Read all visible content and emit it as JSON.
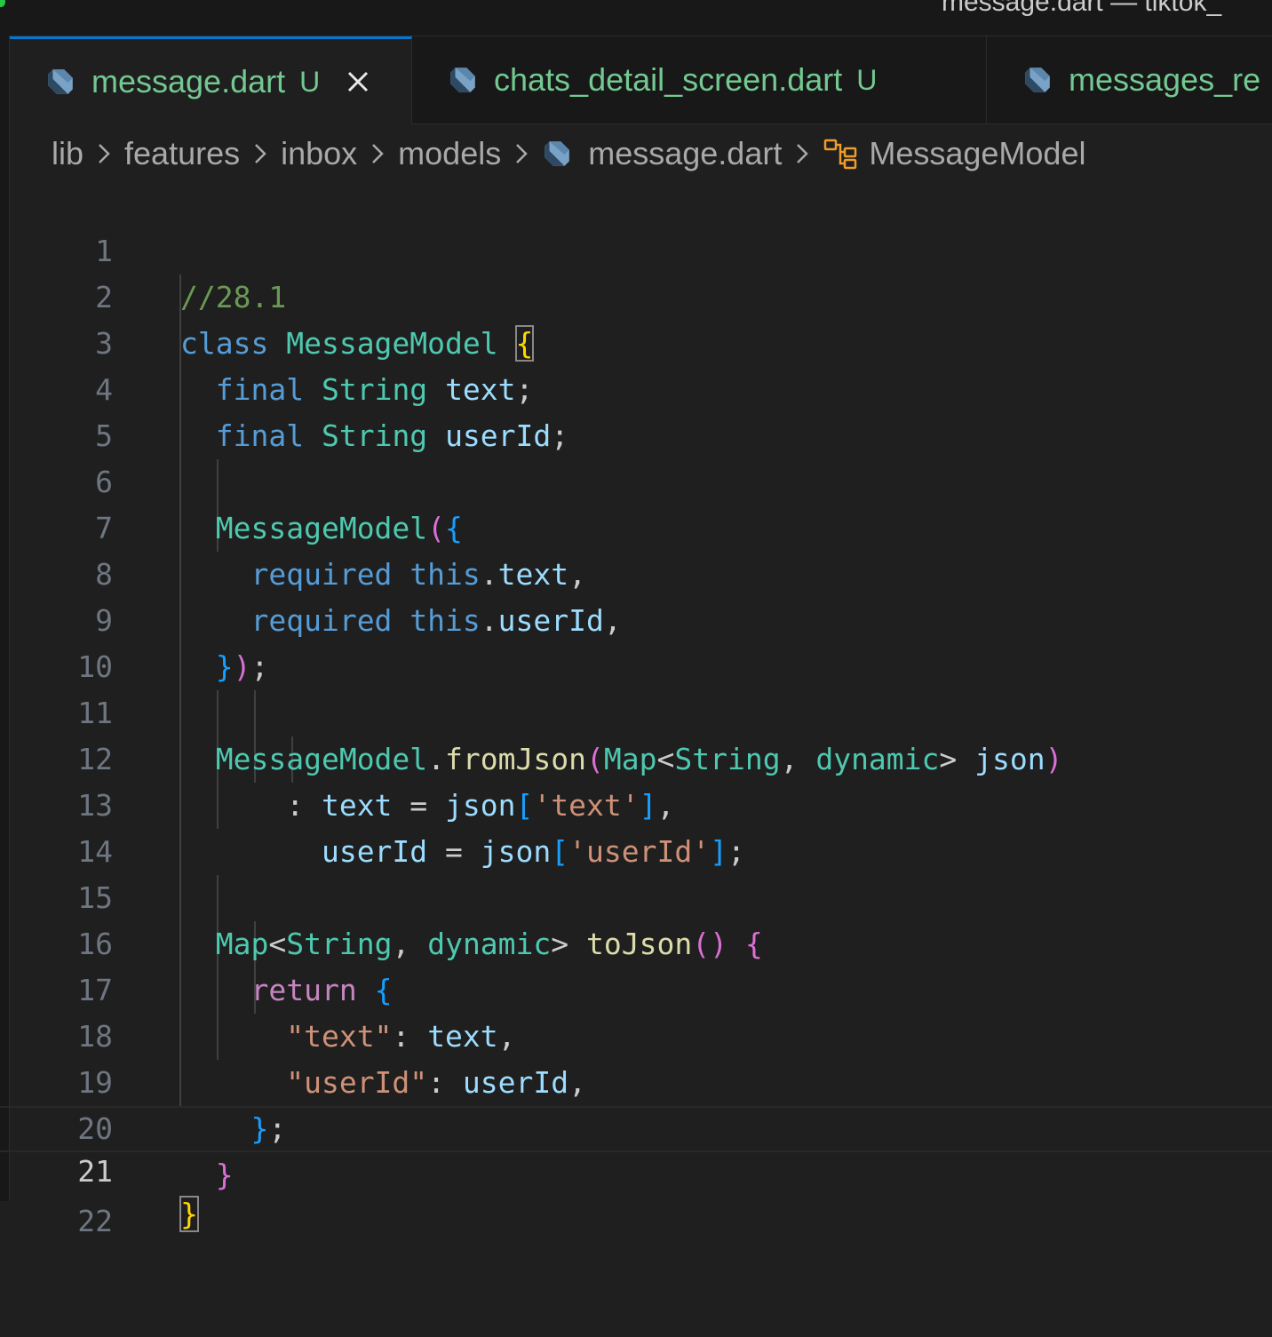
{
  "window": {
    "title": "message.dart — tiktok_"
  },
  "tabs": [
    {
      "label": "message.dart",
      "status": "U",
      "active": true,
      "icon": "dart-file-icon"
    },
    {
      "label": "chats_detail_screen.dart",
      "status": "U",
      "active": false,
      "icon": "dart-file-icon"
    },
    {
      "label": "messages_re",
      "status": "",
      "active": false,
      "icon": "dart-file-icon"
    }
  ],
  "breadcrumb": {
    "items": [
      "lib",
      "features",
      "inbox",
      "models",
      "message.dart",
      "MessageModel"
    ],
    "file_icon": "dart-file-icon",
    "symbol_icon": "class-symbol-icon"
  },
  "editor": {
    "current_line": 21,
    "line_numbers": [
      "1",
      "2",
      "3",
      "4",
      "5",
      "6",
      "7",
      "8",
      "9",
      "10",
      "11",
      "12",
      "13",
      "14",
      "15",
      "16",
      "17",
      "18",
      "19",
      "20",
      "21",
      "22"
    ],
    "lines": [
      "//28.1",
      "class MessageModel {",
      "  final String text;",
      "  final String userId;",
      "",
      "  MessageModel({",
      "    required this.text,",
      "    required this.userId,",
      "  });",
      "",
      "  MessageModel.fromJson(Map<String, dynamic> json)",
      "      : text = json['text'],",
      "        userId = json['userId'];",
      "",
      "  Map<String, dynamic> toJson() {",
      "    return {",
      "      \"text\": text,",
      "      \"userId\": userId,",
      "    };",
      "  }",
      "}",
      ""
    ]
  },
  "colors": {
    "accent": "#0078d4",
    "untracked": "#73c991",
    "keyword": "#569cd6",
    "type": "#4ec9b0",
    "variable": "#9cdcfe",
    "function": "#dcdcaa",
    "string": "#ce9178",
    "comment": "#6a9955",
    "control": "#c586c0",
    "bracket_1": "#ffd700",
    "bracket_2": "#da70d6",
    "bracket_3": "#179fff"
  }
}
